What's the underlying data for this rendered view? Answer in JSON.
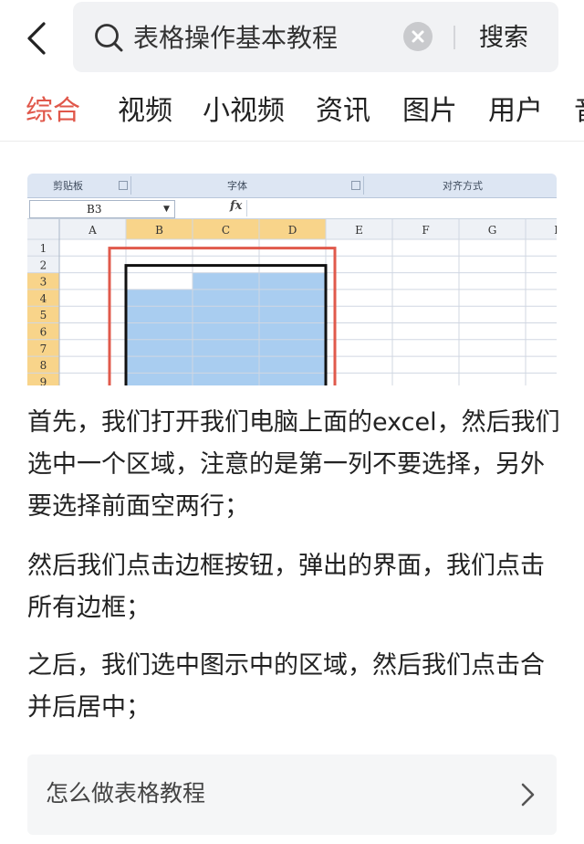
{
  "search": {
    "query": "表格操作基本教程",
    "button_label": "搜索"
  },
  "tabs": [
    {
      "label": "综合",
      "active": true
    },
    {
      "label": "视频"
    },
    {
      "label": "小视频"
    },
    {
      "label": "资讯"
    },
    {
      "label": "图片"
    },
    {
      "label": "用户"
    },
    {
      "label": "音"
    }
  ],
  "excel": {
    "ribbon": {
      "clipboard": "剪贴板",
      "font": "字体",
      "alignment": "对齐方式"
    },
    "name_box": "B3",
    "fx": "fx",
    "columns": [
      "A",
      "B",
      "C",
      "D",
      "E",
      "F",
      "G",
      "H"
    ],
    "rows": [
      "1",
      "2",
      "3",
      "4",
      "5",
      "6",
      "7",
      "8",
      "9"
    ],
    "selection_color": "#a9cdf0",
    "border_color": "#e05a4c"
  },
  "article": {
    "p1": "首先，我们打开我们电脑上面的excel，然后我们选中一个区域，注意的是第一列不要选择，另外要选择前面空两行；",
    "p2": "然后我们点击边框按钮，弹出的界面，我们点击所有边框；",
    "p3": "之后，我们选中图示中的区域，然后我们点击合并后居中；"
  },
  "related": {
    "label": "怎么做表格教程"
  },
  "colors": {
    "accent": "#e0574a",
    "search_bg": "#f1f2f4",
    "card_bg": "#f5f6f7"
  }
}
